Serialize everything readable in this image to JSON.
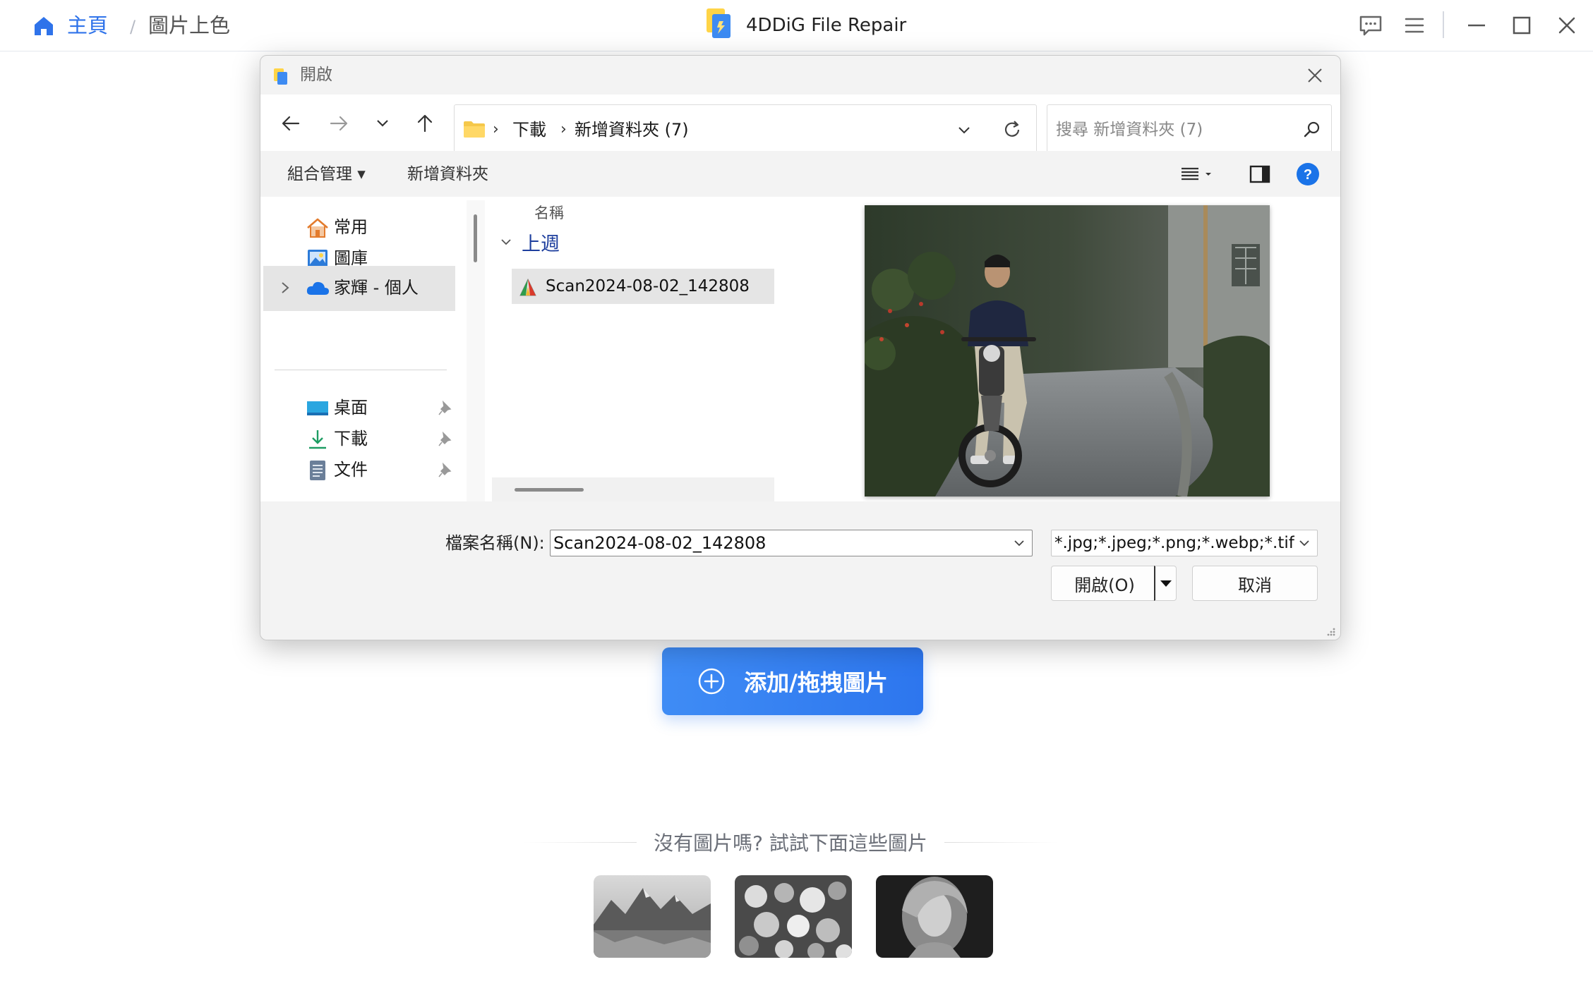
{
  "app": {
    "title": "4DDiG File Repair",
    "breadcrumb": {
      "home": "主頁",
      "separator": "/",
      "current": "圖片上色"
    },
    "icons": [
      "home-icon",
      "app-logo",
      "feedback-icon",
      "menu-icon",
      "minimize-icon",
      "maximize-icon",
      "close-icon"
    ],
    "accent": "#2f73ea"
  },
  "main": {
    "add_button_label": "添加/拖拽圖片",
    "samples_title": "沒有圖片嗎? 試試下面這些圖片",
    "samples": [
      "sample-mountain-lake",
      "sample-flowers",
      "sample-portrait"
    ]
  },
  "dialog": {
    "title": "開啟",
    "address": {
      "segments": [
        "下載",
        "新增資料夾 (7)"
      ]
    },
    "search_placeholder": "搜尋 新增資料夾 (7)",
    "commands": {
      "organize": "組合管理",
      "new_folder": "新增資料夾"
    },
    "nav": {
      "items": [
        {
          "label": "常用",
          "icon": "home-icon"
        },
        {
          "label": "圖庫",
          "icon": "gallery-icon"
        },
        {
          "label": "家輝 - 個人",
          "icon": "onedrive-cloud-icon"
        }
      ],
      "quick_access": [
        {
          "label": "桌面",
          "icon": "desktop-icon"
        },
        {
          "label": "下載",
          "icon": "download-icon"
        },
        {
          "label": "文件",
          "icon": "document-icon"
        }
      ]
    },
    "files": {
      "column_header": "名稱",
      "group": "上週",
      "items": [
        {
          "name": "Scan2024-08-02_142808"
        }
      ]
    },
    "filename_label": "檔案名稱(N):",
    "filename_value": "Scan2024-08-02_142808",
    "filetype_value": "*.jpg;*.jpeg;*.png;*.webp;*.tif;*",
    "open_label": "開啟(O)",
    "cancel_label": "取消"
  }
}
